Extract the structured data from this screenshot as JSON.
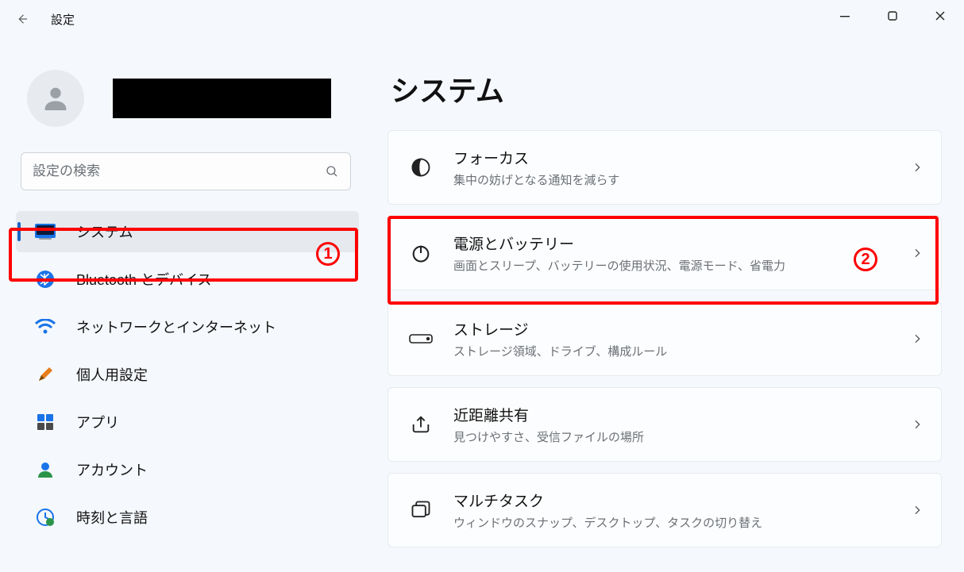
{
  "app_title": "設定",
  "search_placeholder": "設定の検索",
  "page_heading": "システム",
  "annotations": {
    "num1": "1",
    "num2": "2"
  },
  "sidebar": {
    "items": [
      {
        "label": "システム"
      },
      {
        "label": "Bluetooth とデバイス"
      },
      {
        "label": "ネットワークとインターネット"
      },
      {
        "label": "個人用設定"
      },
      {
        "label": "アプリ"
      },
      {
        "label": "アカウント"
      },
      {
        "label": "時刻と言語"
      }
    ]
  },
  "cards": [
    {
      "title": "フォーカス",
      "sub": "集中の妨げとなる通知を減らす"
    },
    {
      "title": "電源とバッテリー",
      "sub": "画面とスリープ、バッテリーの使用状況、電源モード、省電力"
    },
    {
      "title": "ストレージ",
      "sub": "ストレージ領域、ドライブ、構成ルール"
    },
    {
      "title": "近距離共有",
      "sub": "見つけやすさ、受信ファイルの場所"
    },
    {
      "title": "マルチタスク",
      "sub": "ウィンドウのスナップ、デスクトップ、タスクの切り替え"
    }
  ]
}
